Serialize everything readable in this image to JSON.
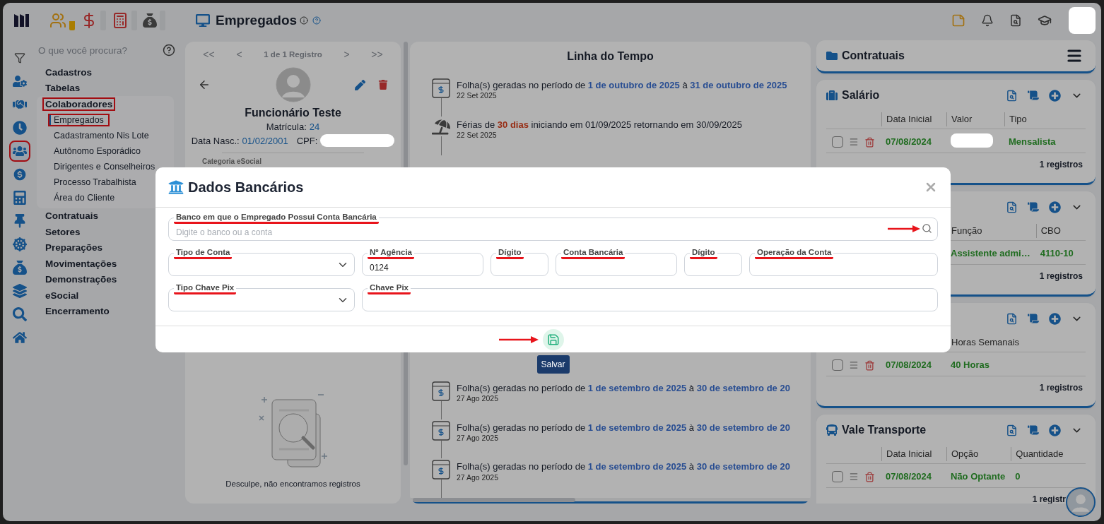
{
  "top_bar": {
    "modules": [
      {
        "selected": true
      },
      {
        "selected": false
      },
      {
        "selected": false
      },
      {
        "selected": false
      }
    ],
    "page_title": "Empregados"
  },
  "search": {
    "placeholder": "O que você procura?"
  },
  "nav_rail": [
    {
      "selected": false,
      "annotated": false
    },
    {
      "selected": false,
      "annotated": false
    },
    {
      "selected": false,
      "annotated": false
    },
    {
      "selected": true,
      "annotated": true
    },
    {
      "selected": false,
      "annotated": false
    },
    {
      "selected": false,
      "annotated": false
    },
    {
      "selected": false,
      "annotated": false
    },
    {
      "selected": false,
      "annotated": false
    },
    {
      "selected": false,
      "annotated": false
    },
    {
      "selected": false,
      "annotated": false
    },
    {
      "selected": false,
      "annotated": false
    },
    {
      "selected": false,
      "annotated": false
    }
  ],
  "menu": [
    {
      "label": "Cadastros",
      "expanded": false,
      "annotated": false
    },
    {
      "label": "Tabelas",
      "expanded": false,
      "annotated": false
    },
    {
      "label": "Colaboradores",
      "expanded": true,
      "annotated": true,
      "children": [
        {
          "label": "Empregados",
          "selected": true,
          "annotated": true
        },
        {
          "label": "Cadastramento Nis Lote",
          "selected": false,
          "annotated": false
        },
        {
          "label": "Autônomo Esporádico",
          "selected": false,
          "annotated": false
        },
        {
          "label": "Dirigentes e Conselheiros",
          "selected": false,
          "annotated": false
        },
        {
          "label": "Processo Trabalhista",
          "selected": false,
          "annotated": false
        },
        {
          "label": "Área do Cliente",
          "selected": false,
          "annotated": false
        }
      ]
    },
    {
      "label": "Contratuais",
      "expanded": false,
      "annotated": false
    },
    {
      "label": "Setores",
      "expanded": false,
      "annotated": false
    },
    {
      "label": "Preparações",
      "expanded": false,
      "annotated": false
    },
    {
      "label": "Movimentações",
      "expanded": false,
      "annotated": false
    },
    {
      "label": "Demonstrações",
      "expanded": false,
      "annotated": false
    },
    {
      "label": "eSocial",
      "expanded": false,
      "annotated": false
    },
    {
      "label": "Encerramento",
      "expanded": false,
      "annotated": false
    }
  ],
  "employee": {
    "pager": {
      "first": "<<",
      "prev": "<",
      "status": "1 de 1 Registro",
      "next": ">",
      "last": ">>"
    },
    "name": "Funcionário Teste",
    "registration_label": "Matrícula:",
    "registration": "24",
    "birth_label": "Data Nasc.:",
    "birth_date": "01/02/2001",
    "cpf_label": "CPF:",
    "cpf_redacted": true,
    "section_label": "Categoria eSocial",
    "empty_message": "Desculpe, não encontramos registros"
  },
  "timeline": {
    "title": "Linha do Tempo",
    "items": [
      {
        "kind": "payroll",
        "text": "Folha(s) geradas no período de **1 de outubro de 2025** à **31 de outubro de 2025**",
        "date": "22 Set 2025"
      },
      {
        "kind": "vacation",
        "text": "Férias de **30 dias** iniciando em 01/09/2025 retornando em 30/09/2025",
        "date": "22 Set 2025"
      },
      {
        "kind": "payroll",
        "text": "Folha(s) geradas no período de **1 de setembro de 2025** à **30 de setembro de 20**",
        "date": "27 Ago 2025"
      },
      {
        "kind": "payroll",
        "text": "Folha(s) geradas no período de **1 de setembro de 2025** à **30 de setembro de 20**",
        "date": "27 Ago 2025"
      },
      {
        "kind": "payroll",
        "text": "Folha(s) geradas no período de **1 de setembro de 2025** à **30 de setembro de 20**",
        "date": "27 Ago 2025"
      }
    ]
  },
  "contracts": {
    "title": "Contratuais",
    "cards": [
      {
        "kind": "salary",
        "title": "Salário",
        "columns": [
          "Data Inicial",
          "Valor",
          "Tipo"
        ],
        "rows": [
          {
            "controls": true,
            "checked": false,
            "cells": [
              {
                "kind": "text",
                "text": "07/08/2024"
              },
              {
                "kind": "redacted"
              },
              {
                "kind": "text",
                "text": "Mensalista"
              }
            ]
          }
        ],
        "footer": "1 registros"
      },
      {
        "kind": "covered",
        "columns": [
          "Função",
          "CBO"
        ],
        "rows": [
          {
            "controls": false,
            "cells": [
              {
                "kind": "text",
                "text": "Assistente admi…"
              },
              {
                "kind": "text",
                "text": "4110-10"
              }
            ]
          }
        ],
        "footer": "1 registros"
      },
      {
        "kind": "covered",
        "columns": [
          "",
          "Horas Semanais"
        ],
        "rows": [
          {
            "controls": true,
            "checked": false,
            "cells": [
              {
                "kind": "text",
                "text": "07/08/2024"
              },
              {
                "kind": "text",
                "text": "40 Horas"
              }
            ]
          }
        ],
        "footer": "1 registros"
      },
      {
        "kind": "transport",
        "title": "Vale Transporte",
        "columns": [
          "Data Inicial",
          "Opção",
          "Quantidade"
        ],
        "rows": [
          {
            "controls": true,
            "checked": false,
            "cells": [
              {
                "kind": "text",
                "text": "07/08/2024"
              },
              {
                "kind": "text",
                "text": "Não Optante"
              },
              {
                "kind": "text",
                "text": "0"
              }
            ]
          }
        ],
        "footer": "1 registr"
      }
    ]
  },
  "modal": {
    "title": "Dados Bancários",
    "rows": [
      [
        {
          "kind": "search",
          "label": "Banco em que o Empregado Possui Conta Bancária",
          "placeholder": "Digite o banco ou a conta",
          "annotated": true,
          "arrow": true
        }
      ],
      [
        {
          "kind": "select",
          "label": "Tipo de Conta",
          "annotated": true,
          "arrow": false
        },
        {
          "kind": "text",
          "label": "Nº Agência",
          "value": "0124",
          "annotated": true,
          "arrow": false
        },
        {
          "kind": "text",
          "label": "Dígito",
          "annotated": true,
          "arrow": false
        },
        {
          "kind": "text",
          "label": "Conta Bancária",
          "annotated": true,
          "arrow": false
        },
        {
          "kind": "text",
          "label": "Dígito",
          "annotated": true,
          "arrow": false
        },
        {
          "kind": "text",
          "label": "Operação da Conta",
          "annotated": true,
          "arrow": false
        }
      ],
      [
        {
          "kind": "select",
          "label": "Tipo Chave Pix",
          "annotated": true,
          "arrow": false
        },
        {
          "kind": "text",
          "label": "Chave Pix",
          "annotated": true,
          "arrow": false
        }
      ]
    ],
    "save": {
      "label": "Salvar",
      "arrow": true
    }
  }
}
